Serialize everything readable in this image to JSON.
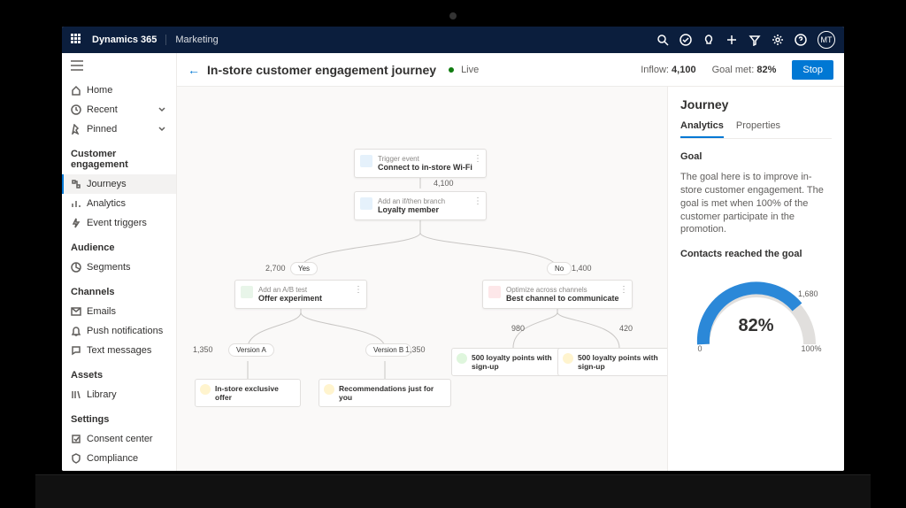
{
  "topbar": {
    "brand": "Dynamics 365",
    "app": "Marketing",
    "avatar": "MT"
  },
  "sidebar": {
    "home": "Home",
    "recent": "Recent",
    "pinned": "Pinned",
    "sections": {
      "engagement": {
        "head": "Customer engagement",
        "journeys": "Journeys",
        "analytics": "Analytics",
        "triggers": "Event triggers"
      },
      "audience": {
        "head": "Audience",
        "segments": "Segments"
      },
      "channels": {
        "head": "Channels",
        "emails": "Emails",
        "push": "Push notifications",
        "text": "Text messages"
      },
      "assets": {
        "head": "Assets",
        "library": "Library"
      },
      "settings": {
        "head": "Settings",
        "consent": "Consent center",
        "compliance": "Compliance"
      }
    }
  },
  "header": {
    "title": "In-store customer engagement journey",
    "status": "Live",
    "inflow_label": "Inflow:",
    "inflow": "4,100",
    "goal_label": "Goal met:",
    "goal": "82%",
    "stop": "Stop"
  },
  "panel": {
    "title": "Journey",
    "tab_analytics": "Analytics",
    "tab_properties": "Properties",
    "goal_head": "Goal",
    "goal_text": "The goal here is to improve in-store customer engagement. The goal is met when 100% of the customer participate in the promotion.",
    "chart_head": "Contacts reached the goal"
  },
  "chart_data": {
    "type": "gauge",
    "value_pct": 82,
    "value_count": 1680,
    "min": 0,
    "max_label": "100%",
    "min_label": "0",
    "top_label": "1,680",
    "display": "82%"
  },
  "flow": {
    "n1_sup": "Trigger event",
    "n1": "Connect to in-store Wi-Fi",
    "count_4100": "4,100",
    "n2_sup": "Add an if/then branch",
    "n2": "Loyalty member",
    "yes": "Yes",
    "no": "No",
    "c_yes": "2,700",
    "c_no": "1,400",
    "n3_sup": "Add an A/B test",
    "n3": "Offer experiment",
    "n4_sup": "Optimize across channels",
    "n4": "Best channel to communicate",
    "va": "Version A",
    "vb": "Version B",
    "c_va": "1,350",
    "c_vb": "1,350",
    "c_980": "980",
    "c_420": "420",
    "leaf1": "In-store exclusive offer",
    "leaf2": "Recommendations just for you",
    "leaf3": "500 loyalty points with sign-up",
    "leaf4": "500 loyalty points with sign-up"
  }
}
